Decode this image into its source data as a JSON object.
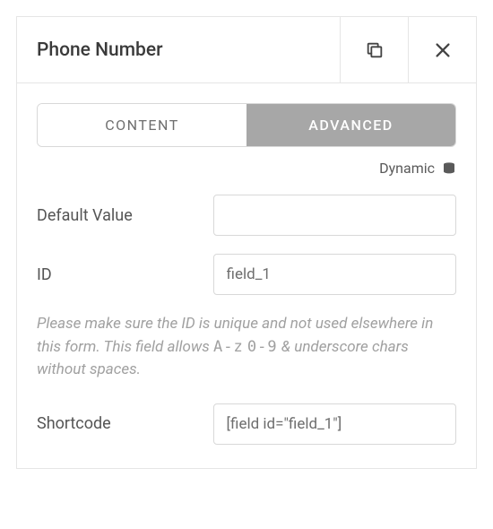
{
  "header": {
    "title": "Phone Number"
  },
  "tabs": {
    "content": "CONTENT",
    "advanced": "ADVANCED"
  },
  "dynamic": {
    "label": "Dynamic"
  },
  "fields": {
    "default_value": {
      "label": "Default Value",
      "value": ""
    },
    "id": {
      "label": "ID",
      "value": "field_1",
      "help_prefix": "Please make sure the ID is unique and not used elsewhere in this form. This field allows ",
      "help_mono1": "A-z",
      "help_mid": " ",
      "help_mono2": "0-9",
      "help_suffix": " & underscore chars without spaces."
    },
    "shortcode": {
      "label": "Shortcode",
      "value": "[field id=\"field_1\"]"
    }
  }
}
